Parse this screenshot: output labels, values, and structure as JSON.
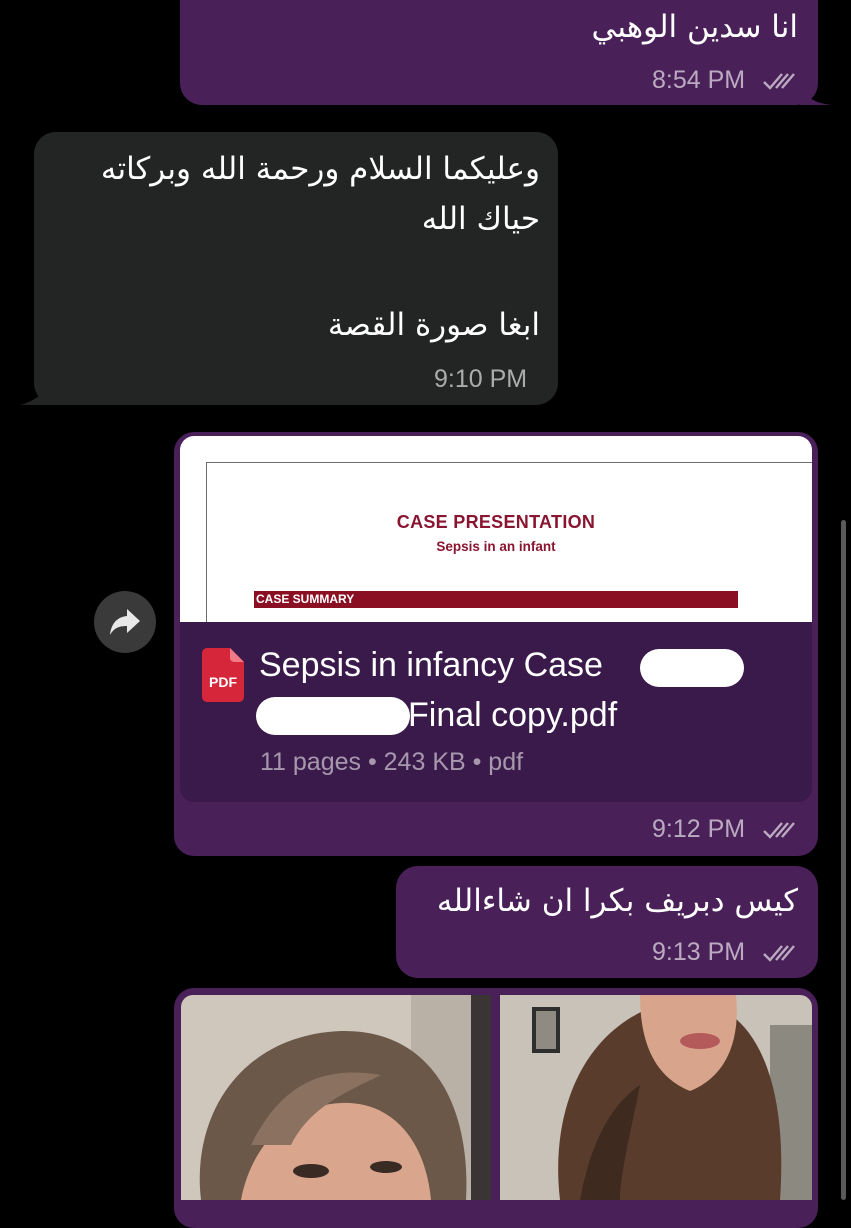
{
  "messages": [
    {
      "direction": "outgoing",
      "text": "انا سدين الوهبي",
      "time": "8:54 PM",
      "status": "read"
    },
    {
      "direction": "incoming",
      "lines": [
        "وعليكما السلام ورحمة الله وبركاته",
        "حياك الله",
        "",
        "ابغا صورة القصة"
      ],
      "time": "9:10 PM"
    },
    {
      "direction": "outgoing",
      "type": "document",
      "preview": {
        "heading": "CASE PRESENTATION",
        "subheading": "Sepsis in an infant",
        "section_bar": "CASE SUMMARY"
      },
      "file_icon_label": "PDF",
      "file_name_line1": "Sepsis in infancy Case",
      "file_name_line2": "Final copy.pdf",
      "file_meta": "11 pages • 243 KB • pdf",
      "time": "9:12 PM",
      "status": "read"
    },
    {
      "direction": "outgoing",
      "text": "كيس دبريف بكرا ان شاءالله",
      "time": "9:13 PM",
      "status": "read"
    },
    {
      "direction": "outgoing",
      "type": "photos",
      "photo_count": 2
    }
  ],
  "icons": {
    "forward": "forward-arrow-icon",
    "read_receipt": "double-check-icon",
    "pdf": "pdf-file-icon"
  },
  "colors": {
    "background": "#000000",
    "outgoing_bubble": "#4a2059",
    "incoming_bubble": "#232424",
    "file_card": "#3a1a4a",
    "pdf_red": "#8a1530",
    "pdf_icon_red": "#d6263a"
  }
}
